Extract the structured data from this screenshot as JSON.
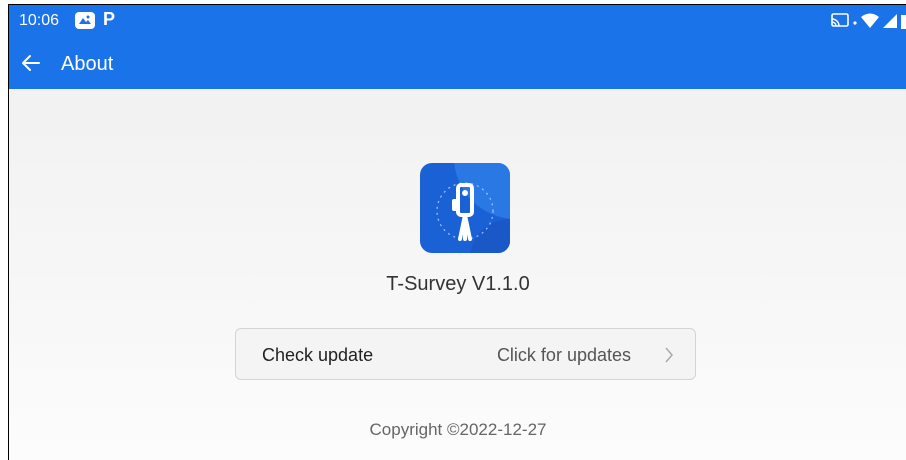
{
  "status_bar": {
    "time": "10:06",
    "icons": [
      "gallery-notification-icon",
      "p-notification-icon",
      "cast-icon",
      "wifi-icon",
      "signal-icon",
      "battery-icon"
    ],
    "notif_letter": "P"
  },
  "app_bar": {
    "title": "About",
    "back_icon": "arrow-left-icon"
  },
  "about": {
    "app_name": "T-Survey V1.1.0",
    "logo_icon": "surveyor-instrument-icon"
  },
  "update": {
    "label": "Check update",
    "value": "Click for updates",
    "chevron_icon": "chevron-right-icon"
  },
  "footer": {
    "copyright": "Copyright ©2022-12-27"
  },
  "colors": {
    "primary": "#1a73e8",
    "logo_bg": "#1b61d6",
    "background": "#f3f3f3"
  }
}
